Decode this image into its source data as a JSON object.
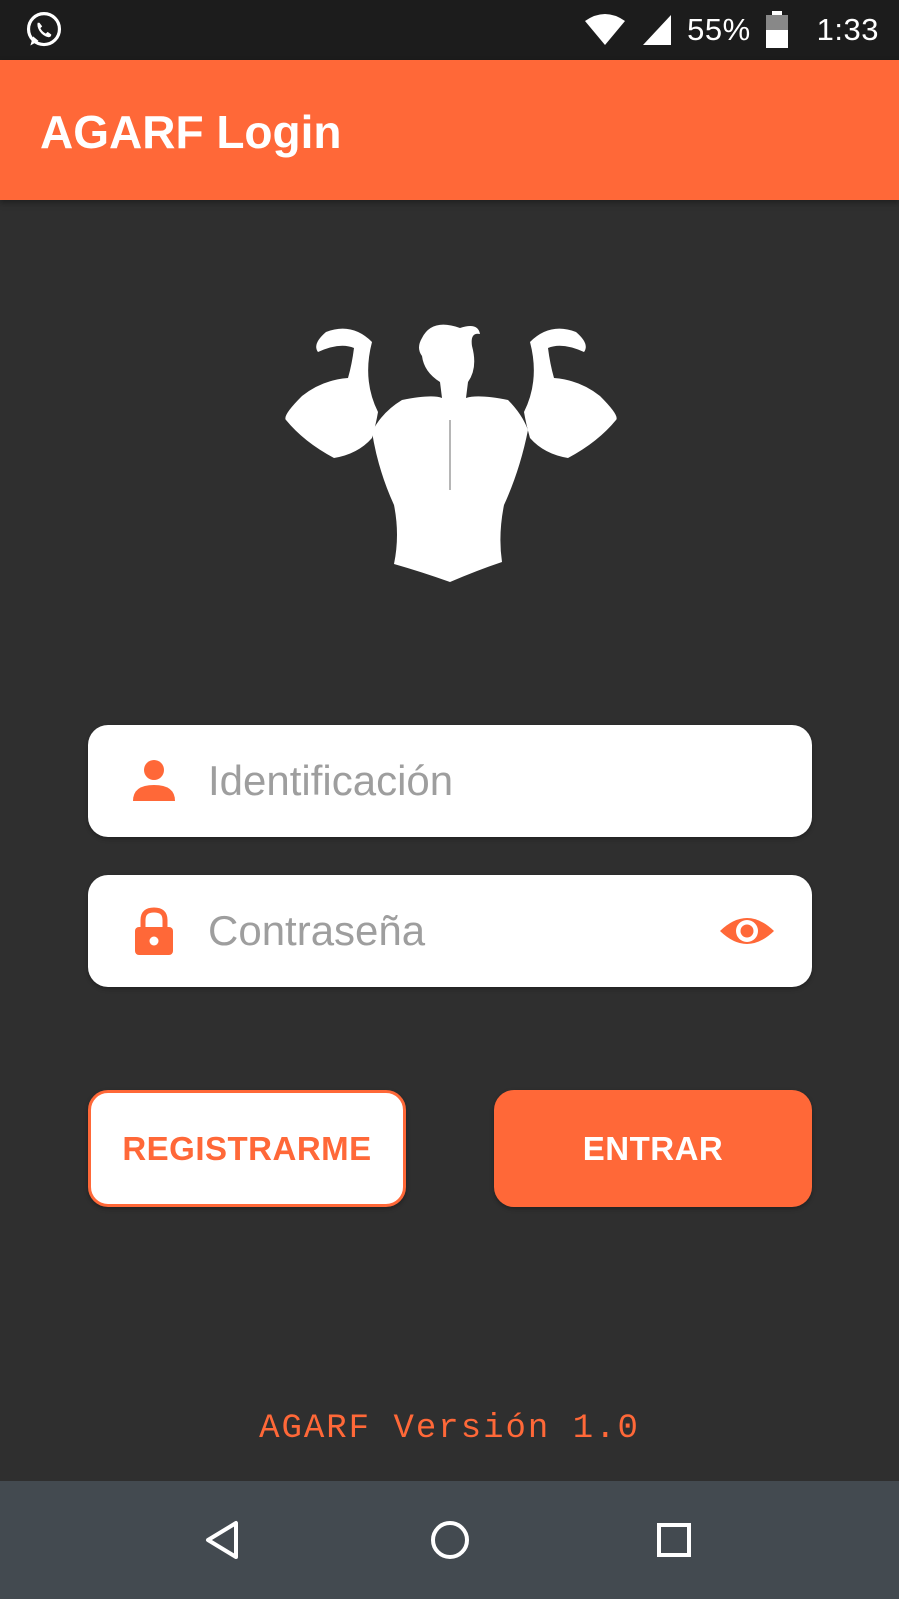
{
  "status_bar": {
    "notification_icon": "whatsapp-icon",
    "battery_percent": "55%",
    "time": "1:33",
    "icons": [
      "wifi-icon",
      "signal-icon",
      "battery-icon"
    ]
  },
  "app_bar": {
    "title": "AGARF Login"
  },
  "logo": {
    "icon": "bodybuilder-flex-icon"
  },
  "form": {
    "id_field": {
      "icon": "person-icon",
      "placeholder": "Identificación",
      "value": ""
    },
    "password_field": {
      "icon": "lock-icon",
      "placeholder": "Contraseña",
      "value": "",
      "toggle_icon": "eye-icon"
    }
  },
  "buttons": {
    "register_label": "REGISTRARME",
    "enter_label": "ENTRAR"
  },
  "footer": {
    "version_text": "AGARF Versión 1.0"
  },
  "nav_bar": {
    "back_icon": "back-triangle-icon",
    "home_icon": "home-circle-icon",
    "recent_icon": "recents-square-icon"
  },
  "colors": {
    "accent": "#ff6838",
    "background": "#2f2f2f",
    "status_bar": "#1c1c1c",
    "nav_bar": "#434a50",
    "field_background": "#ffffff",
    "placeholder_text": "#9e9e9e"
  }
}
